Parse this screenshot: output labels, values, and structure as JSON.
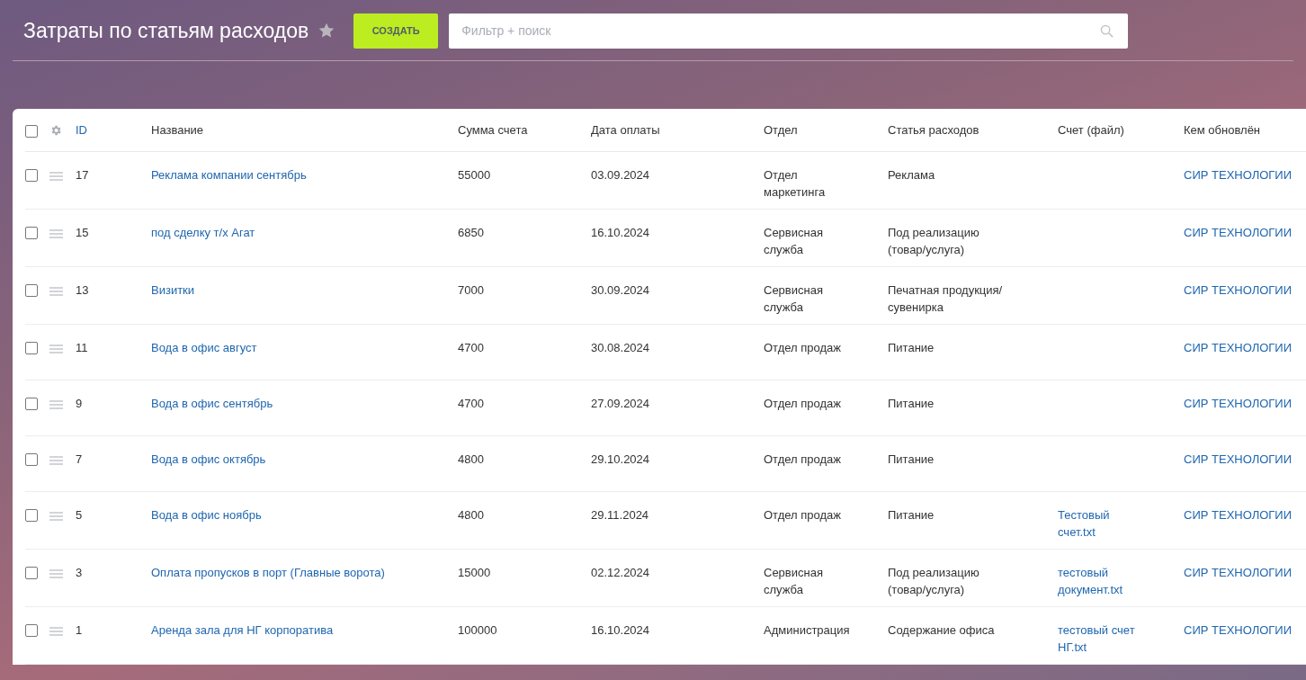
{
  "page_title": "Затраты по статьям расходов",
  "favorite": false,
  "create_button": "СОЗДАТЬ",
  "search": {
    "placeholder": "Фильтр + поиск"
  },
  "table": {
    "select_all_checked": false,
    "columns": [
      "ID",
      "Название",
      "Сумма счета",
      "Дата оплаты",
      "Отдел",
      "Статья расходов",
      "Счет (файл)",
      "Кем обновлён"
    ],
    "rows": [
      {
        "checked": false,
        "id": "17",
        "name": "Реклама компании сентябрь",
        "sum": "55000",
        "date": "03.09.2024",
        "department": "Отдел маркетинга",
        "category": "Реклама",
        "file": "",
        "updated_by": "СИР ТЕХНОЛОГИИ"
      },
      {
        "checked": false,
        "id": "15",
        "name": "под сделку т/х Агат",
        "sum": "6850",
        "date": "16.10.2024",
        "department": "Сервисная служба",
        "category": "Под реализацию (товар/услуга)",
        "file": "",
        "updated_by": "СИР ТЕХНОЛОГИИ"
      },
      {
        "checked": false,
        "id": "13",
        "name": "Визитки",
        "sum": "7000",
        "date": "30.09.2024",
        "department": "Сервисная служба",
        "category": "Печатная продукция/ сувенирка",
        "file": "",
        "updated_by": "СИР ТЕХНОЛОГИИ"
      },
      {
        "checked": false,
        "id": "11",
        "name": "Вода в офис август",
        "sum": "4700",
        "date": "30.08.2024",
        "department": "Отдел продаж",
        "category": "Питание",
        "file": "",
        "updated_by": "СИР ТЕХНОЛОГИИ"
      },
      {
        "checked": false,
        "id": "9",
        "name": "Вода в офис сентябрь",
        "sum": "4700",
        "date": "27.09.2024",
        "department": "Отдел продаж",
        "category": "Питание",
        "file": "",
        "updated_by": "СИР ТЕХНОЛОГИИ"
      },
      {
        "checked": false,
        "id": "7",
        "name": "Вода в офис октябрь",
        "sum": "4800",
        "date": "29.10.2024",
        "department": "Отдел продаж",
        "category": "Питание",
        "file": "",
        "updated_by": "СИР ТЕХНОЛОГИИ"
      },
      {
        "checked": false,
        "id": "5",
        "name": "Вода в офис ноябрь",
        "sum": "4800",
        "date": "29.11.2024",
        "department": "Отдел продаж",
        "category": "Питание",
        "file": "Тестовый счет.txt",
        "updated_by": "СИР ТЕХНОЛОГИИ"
      },
      {
        "checked": false,
        "id": "3",
        "name": "Оплата пропусков в порт (Главные ворота)",
        "sum": "15000",
        "date": "02.12.2024",
        "department": "Сервисная служба",
        "category": "Под реализацию (товар/услуга)",
        "file": "тестовый документ.txt",
        "updated_by": "СИР ТЕХНОЛОГИИ"
      },
      {
        "checked": false,
        "id": "1",
        "name": "Аренда зала для НГ корпоратива",
        "sum": "100000",
        "date": "16.10.2024",
        "department": "Администрация",
        "category": "Содержание офиса",
        "file": "тестовый счет НГ.txt",
        "updated_by": "СИР ТЕХНОЛОГИИ"
      }
    ]
  }
}
